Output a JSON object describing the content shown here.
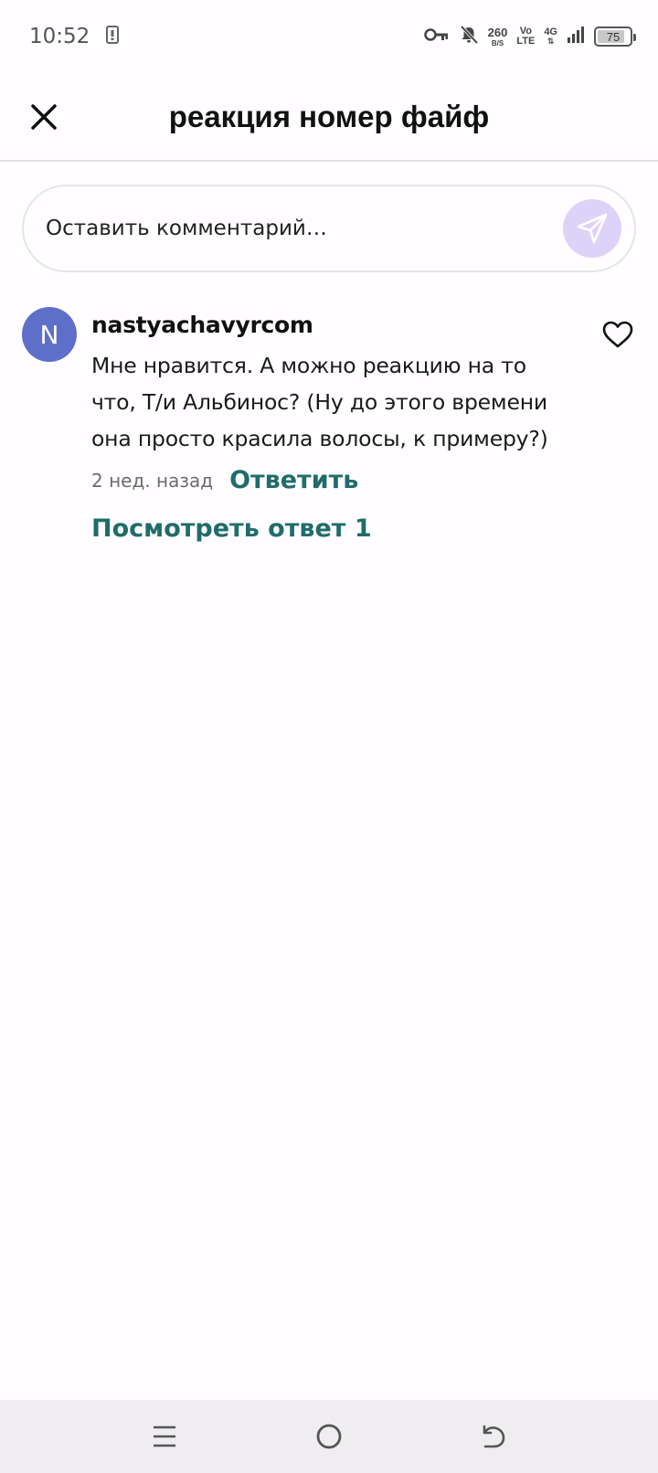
{
  "status_bar": {
    "time": "10:52",
    "net_speed": "260",
    "net_unit": "B/S",
    "volte_top": "Vo",
    "volte_bottom": "LTE",
    "network": "4G",
    "battery": "75",
    "battery_level_percent": 75
  },
  "header": {
    "title": "реакция номер файф",
    "close_icon": "close-icon"
  },
  "comment_input": {
    "placeholder": "Оставить комментарий…",
    "send_icon": "send-icon",
    "send_bg": "#ddd3f8"
  },
  "comment": {
    "avatar_letter": "N",
    "avatar_color": "#5e6fc9",
    "username": "nastyachavyrcom",
    "text": "Мне нравится. А можно реакцию на то что, Т/и Альбинос? (Ну до этого времени она просто красила волосы, к примеру?)",
    "time": "2 нед. назад",
    "reply_label": "Ответить",
    "view_replies_label": "Посмотреть ответ 1",
    "like_icon": "heart-outline-icon",
    "accent_color": "#1f6d6a"
  },
  "nav_bar": {
    "menu_icon": "menu-icon",
    "home_icon": "home-circle-icon",
    "back_icon": "back-icon"
  }
}
